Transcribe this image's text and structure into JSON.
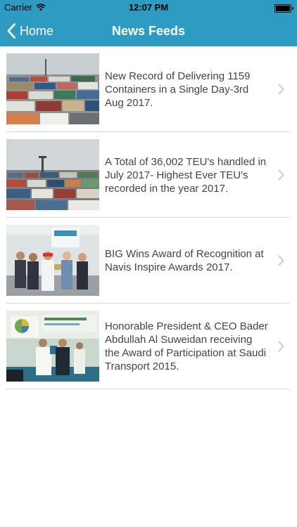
{
  "status_bar": {
    "carrier": "Carrier",
    "time": "12:07 PM"
  },
  "nav": {
    "back_label": "Home",
    "title": "News Feeds"
  },
  "feeds": [
    {
      "title": "New Record of Delivering 1159 Containers in a Single Day-3rd Aug 2017.",
      "image": "container-yard"
    },
    {
      "title": "A Total of 36,002 TEU's handled in July 2017- Highest Ever TEU's recorded in the year 2017.",
      "image": "container-yard"
    },
    {
      "title": "BIG Wins Award of Recognition at Navis Inspire Awards 2017.",
      "image": "award-group"
    },
    {
      "title": "Honorable President & CEO Bader Abdullah Al Suweidan receiving the Award of Participation at Saudi Transport 2015.",
      "image": "award-ceremony"
    }
  ],
  "colors": {
    "nav_bg": "#2d9bc2",
    "text": "#444444",
    "divider": "#d9d9d9"
  }
}
